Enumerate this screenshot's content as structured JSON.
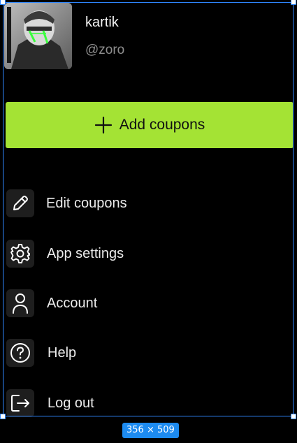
{
  "profile": {
    "name": "kartik",
    "handle": "@zoro"
  },
  "actions": {
    "add_coupons_label": "Add coupons",
    "accent_color": "#a4e334"
  },
  "menu": {
    "items": [
      {
        "label": "Edit coupons",
        "icon": "pencil-icon"
      },
      {
        "label": "App settings",
        "icon": "gear-icon"
      },
      {
        "label": "Account",
        "icon": "user-icon"
      },
      {
        "label": "Help",
        "icon": "question-icon"
      },
      {
        "label": "Log out",
        "icon": "logout-icon"
      }
    ]
  },
  "overlay": {
    "dimensions_label": "356 × 509"
  }
}
